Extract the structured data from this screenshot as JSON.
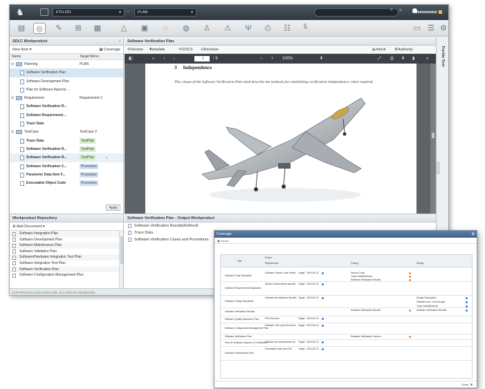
{
  "topbar": {
    "project": "KTH-001",
    "phase": "PLAN",
    "user": "Administrator"
  },
  "left": {
    "title": "SDLC Workproduct",
    "new_item": "New Item",
    "coverage": "Coverage",
    "col_name": "Name",
    "col_menu": "Target Menu",
    "tree": [
      {
        "name": "Planning",
        "menu": "PLAN",
        "level": 0,
        "folder": true,
        "bold": false,
        "tag": ""
      },
      {
        "name": "Software Verification Plan",
        "menu": "",
        "level": 1,
        "folder": false,
        "bold": false,
        "tag": "",
        "sel": true
      },
      {
        "name": "Software Development Plan",
        "menu": "",
        "level": 1,
        "folder": false,
        "bold": false,
        "tag": ""
      },
      {
        "name": "Plan for Software Aspects ...",
        "menu": "",
        "level": 1,
        "folder": false,
        "bold": false,
        "tag": ""
      },
      {
        "name": "Requirement",
        "menu": "Requirement 2",
        "level": 0,
        "folder": true,
        "bold": false,
        "tag": ""
      },
      {
        "name": "Software Verification R...",
        "menu": "",
        "level": 1,
        "folder": false,
        "bold": true,
        "tag": ""
      },
      {
        "name": "Software Requirement...",
        "menu": "",
        "level": 1,
        "folder": false,
        "bold": true,
        "tag": ""
      },
      {
        "name": "Trace Data",
        "menu": "",
        "level": 1,
        "folder": false,
        "bold": true,
        "tag": ""
      },
      {
        "name": "TestCase",
        "menu": "TestCase 2",
        "level": 0,
        "folder": true,
        "bold": false,
        "tag": ""
      },
      {
        "name": "Trace Data",
        "menu": "",
        "level": 1,
        "folder": false,
        "bold": true,
        "tag": "TestPlan"
      },
      {
        "name": "Software Verification R...",
        "menu": "",
        "level": 1,
        "folder": false,
        "bold": true,
        "tag": "TestPlan"
      },
      {
        "name": "Software Verification R...",
        "menu": "",
        "level": 1,
        "folder": false,
        "bold": true,
        "tag": "TestPlan",
        "hl": true
      },
      {
        "name": "Software Verification C...",
        "menu": "",
        "level": 1,
        "folder": false,
        "bold": true,
        "tag": "Procedure"
      },
      {
        "name": "Parameter Data Item F...",
        "menu": "",
        "level": 1,
        "folder": false,
        "bold": true,
        "tag": "Procedure"
      },
      {
        "name": "Executable Object Code",
        "menu": "",
        "level": 1,
        "folder": false,
        "bold": true,
        "tag": "Procedure"
      }
    ],
    "apply": "Apply"
  },
  "repo": {
    "title": "Workproduct Repository",
    "add": "Add Document",
    "items": [
      "Software Integration Plan",
      "Software Development Plan",
      "Software Maintenance Plan",
      "Software Validation Plan",
      "Software/Hardware Integration Test Plan",
      "Software Integration Test Plan",
      "Software Verification Plan",
      "Software Configuration Management Plan"
    ],
    "copyright": "COPYRIGHT(C) 2014-2020 KSE. ALL RIGHTS RESERVED."
  },
  "center": {
    "title": "Software Verification Plan",
    "version": "Version",
    "template": "Template",
    "docs": "DOCS",
    "revision": "Revision History",
    "unlock": "Unlock",
    "authority": "Authority Setting",
    "page_no": "1",
    "page_total": "/ 9",
    "zoom": "100%",
    "heading_num": "3",
    "heading": "Independence",
    "body": "This clause of the Software Verification Plan shall describe the methods for establishing verification independence, when required."
  },
  "output": {
    "title": "Software Verification Plan - Output Workproduct",
    "items": [
      "Software Verification Results(Refined)",
      "Trace Data",
      "Software Verification Cases and Procedures"
    ]
  },
  "right": {
    "label": "Tra-ble Test"
  },
  "coverage": {
    "title": "Coverage",
    "export": "Export",
    "col_title": "Title",
    "col_phase": "Phase",
    "col_requirement": "Requirement",
    "col_coding": "Coding",
    "col_design": "Design",
    "close": "Close",
    "rows": [
      {
        "t": "Software Code Standards",
        "r": "Software Source Code Verific",
        "s": "Target",
        "d": "2019-06-13",
        "c": "Source Code",
        "c2": "Trace Data(Refined)",
        "c3": "Software Verification Results"
      },
      {
        "t": "Software Requirements Standards",
        "r": "System requirements specific",
        "s": "Target",
        "d": "2019-06-13",
        "c": "",
        "c2": "",
        "c3": ""
      },
      {
        "t": "Software Design Standards",
        "r": "Software Architectural Specific",
        "s": "Target",
        "d": "2019-06-13",
        "c": "",
        "c2": "",
        "c3": ""
      },
      {
        "t": "Software Verification Results",
        "r": "",
        "s": "",
        "d": "",
        "c": "Software Verification Results",
        "c2": "",
        "c3": ""
      },
      {
        "t": "Software Quality Assurance Plan",
        "r": "PSD Records",
        "s": "Target",
        "d": "2019-06-13",
        "c": "",
        "c2": "",
        "c3": ""
      },
      {
        "t": "Software Configuration Management Plan",
        "r": "Software Life Cycle Environm",
        "s": "Target",
        "d": "2019-06-13",
        "c": "",
        "c2": "",
        "c3": ""
      },
      {
        "t": "Software Verification Plan",
        "r": "",
        "s": "",
        "d": "",
        "c": "Software Verification Cases a",
        "c2": "",
        "c3": ""
      },
      {
        "t": "Plan for Software Aspects of Certification",
        "r": "Software Accomplishment Su",
        "s": "Target",
        "d": "2019-06-13",
        "c": "",
        "c2": "",
        "c3": ""
      },
      {
        "t": "Software Development Plan",
        "r": "Executable Data Item File",
        "s": "Target",
        "d": "2019-06-13",
        "c": "",
        "c2": "",
        "c3": ""
      }
    ],
    "design": [
      "Design Description",
      "Software Arch. Kind Design",
      "Trace Data(Refined)",
      "Software Verification Results"
    ],
    "colors": {
      "blue": "#3a7bd5",
      "orange": "#f08a24"
    }
  }
}
